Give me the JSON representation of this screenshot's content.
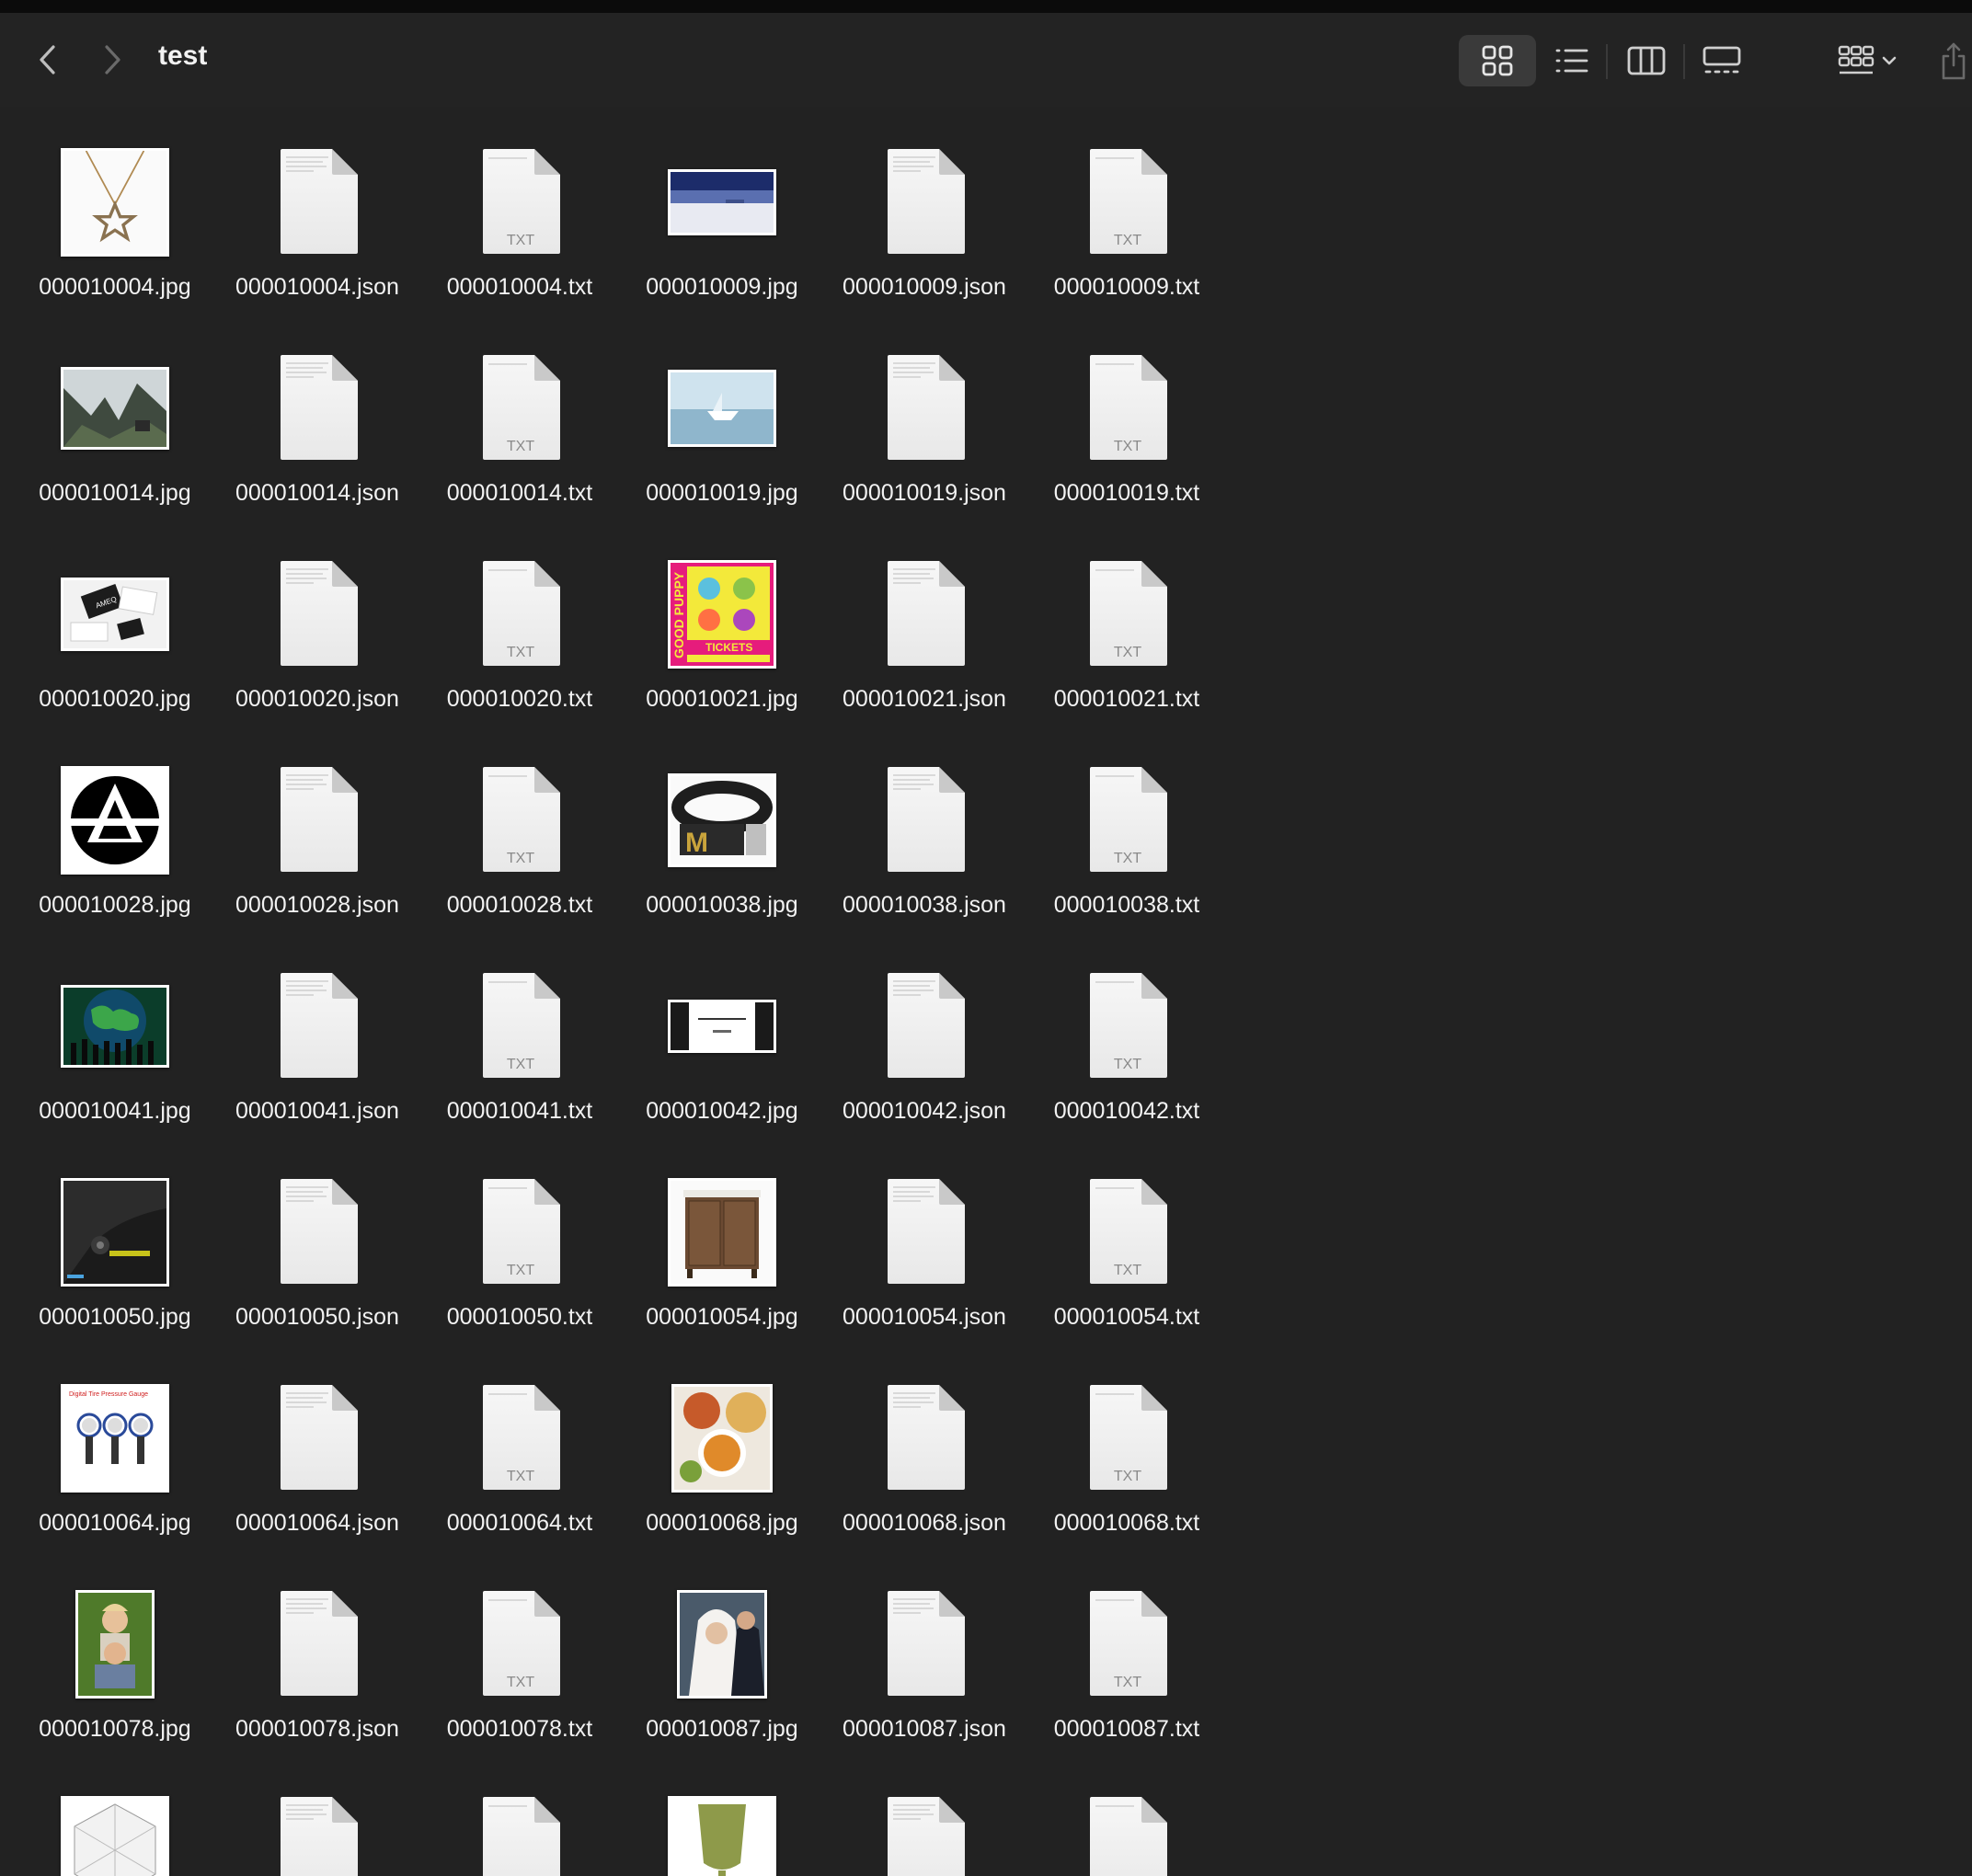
{
  "window": {
    "title": "test"
  },
  "toolbar": {
    "back_icon": "chevron-left-icon",
    "forward_icon": "chevron-right-icon",
    "views": [
      "icon-view-icon",
      "list-view-icon",
      "column-view-icon",
      "gallery-view-icon"
    ],
    "group_icon": "group-by-icon",
    "share_icon": "share-icon"
  },
  "doc_badge": "TXT",
  "files": [
    {
      "name": "000010004.jpg",
      "kind": "jpg",
      "preview": "necklace-star"
    },
    {
      "name": "000010004.json",
      "kind": "json"
    },
    {
      "name": "000010004.txt",
      "kind": "txt"
    },
    {
      "name": "000010009.jpg",
      "kind": "jpg",
      "preview": "salt-flat"
    },
    {
      "name": "000010009.json",
      "kind": "json"
    },
    {
      "name": "000010009.txt",
      "kind": "txt"
    },
    {
      "name": "000010014.jpg",
      "kind": "jpg",
      "preview": "mountain-valley"
    },
    {
      "name": "000010014.json",
      "kind": "json"
    },
    {
      "name": "000010014.txt",
      "kind": "txt"
    },
    {
      "name": "000010019.jpg",
      "kind": "jpg",
      "preview": "paper-boat"
    },
    {
      "name": "000010019.json",
      "kind": "json"
    },
    {
      "name": "000010019.txt",
      "kind": "txt"
    },
    {
      "name": "000010020.jpg",
      "kind": "jpg",
      "preview": "business-cards"
    },
    {
      "name": "000010020.json",
      "kind": "json"
    },
    {
      "name": "000010020.txt",
      "kind": "txt"
    },
    {
      "name": "000010021.jpg",
      "kind": "jpg",
      "preview": "puppy-tickets"
    },
    {
      "name": "000010021.json",
      "kind": "json"
    },
    {
      "name": "000010021.txt",
      "kind": "txt"
    },
    {
      "name": "000010028.jpg",
      "kind": "jpg",
      "preview": "circle-symbol"
    },
    {
      "name": "000010028.json",
      "kind": "json"
    },
    {
      "name": "000010028.txt",
      "kind": "txt"
    },
    {
      "name": "000010038.jpg",
      "kind": "jpg",
      "preview": "belt"
    },
    {
      "name": "000010038.json",
      "kind": "json"
    },
    {
      "name": "000010038.txt",
      "kind": "txt"
    },
    {
      "name": "000010041.jpg",
      "kind": "jpg",
      "preview": "world-people"
    },
    {
      "name": "000010041.json",
      "kind": "json"
    },
    {
      "name": "000010041.txt",
      "kind": "txt"
    },
    {
      "name": "000010042.jpg",
      "kind": "jpg",
      "preview": "banner"
    },
    {
      "name": "000010042.json",
      "kind": "json"
    },
    {
      "name": "000010042.txt",
      "kind": "txt"
    },
    {
      "name": "000010050.jpg",
      "kind": "jpg",
      "preview": "car-interior"
    },
    {
      "name": "000010050.json",
      "kind": "json"
    },
    {
      "name": "000010050.txt",
      "kind": "txt"
    },
    {
      "name": "000010054.jpg",
      "kind": "jpg",
      "preview": "cabinet"
    },
    {
      "name": "000010054.json",
      "kind": "json"
    },
    {
      "name": "000010054.txt",
      "kind": "txt"
    },
    {
      "name": "000010064.jpg",
      "kind": "jpg",
      "preview": "tire-gauges"
    },
    {
      "name": "000010064.json",
      "kind": "json"
    },
    {
      "name": "000010064.txt",
      "kind": "txt"
    },
    {
      "name": "000010068.jpg",
      "kind": "jpg",
      "preview": "food"
    },
    {
      "name": "000010068.json",
      "kind": "json"
    },
    {
      "name": "000010068.txt",
      "kind": "txt"
    },
    {
      "name": "000010078.jpg",
      "kind": "jpg",
      "preview": "family"
    },
    {
      "name": "000010078.json",
      "kind": "json"
    },
    {
      "name": "000010078.txt",
      "kind": "txt"
    },
    {
      "name": "000010087.jpg",
      "kind": "jpg",
      "preview": "wedding"
    },
    {
      "name": "000010087.json",
      "kind": "json"
    },
    {
      "name": "000010087.txt",
      "kind": "txt"
    },
    {
      "name": "",
      "kind": "jpg",
      "preview": "hexagon-drawing"
    },
    {
      "name": "",
      "kind": "json"
    },
    {
      "name": "",
      "kind": "txt"
    },
    {
      "name": "",
      "kind": "jpg",
      "preview": "glass"
    },
    {
      "name": "",
      "kind": "json"
    },
    {
      "name": "",
      "kind": "txt"
    }
  ]
}
